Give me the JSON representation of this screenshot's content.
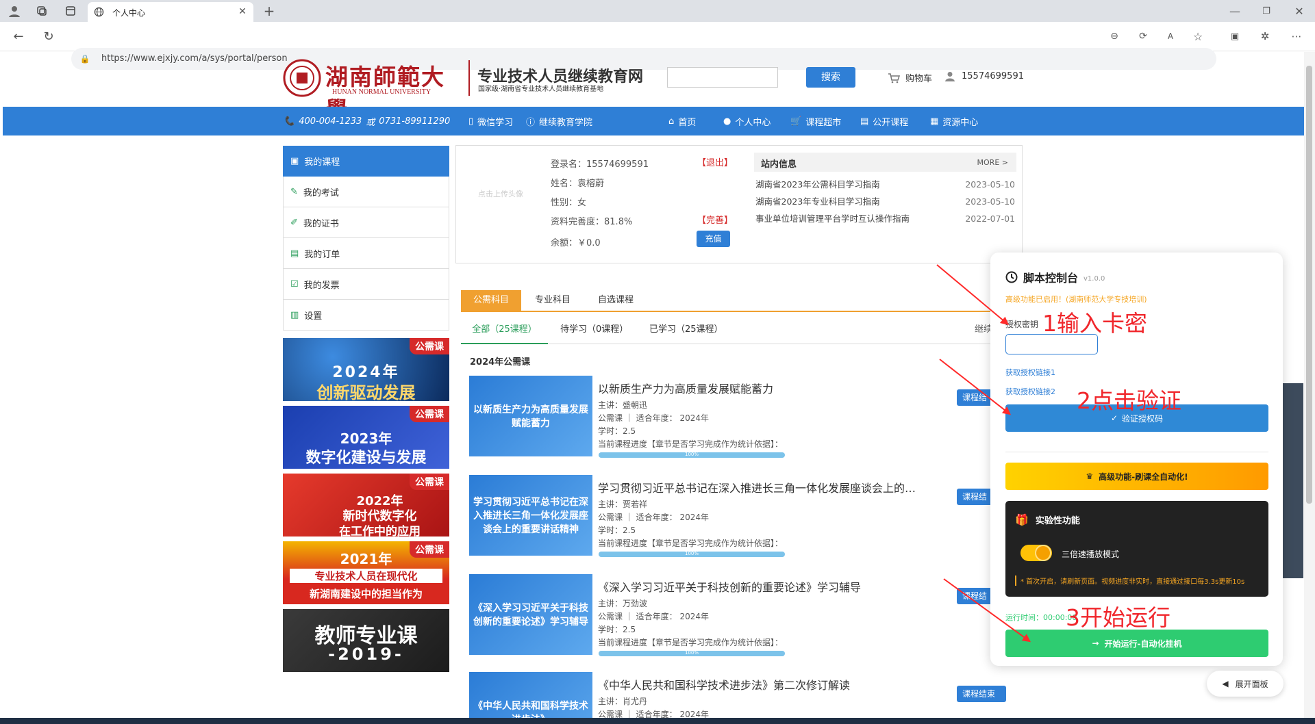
{
  "browser": {
    "tab_title": "个人中心",
    "url": "https://www.ejxjy.com/a/sys/portal/person"
  },
  "header": {
    "logo_cn": "湖南師範大學",
    "logo_en": "HUNAN NORMAL UNIVERSITY",
    "site_name": "专业技术人员继续教育网",
    "site_sub": "国家级·湖南省专业技术人员继续教育基地",
    "search_placeholder": "",
    "search_button": "搜索",
    "cart": "购物车",
    "user": "15574699591"
  },
  "navbar": {
    "phone1": "400-004-1233",
    "or": "或",
    "phone2": "0731-89911290",
    "wechat": "微信学习",
    "college": "继续教育学院",
    "items": [
      "首页",
      "个人中心",
      "课程超市",
      "公开课程",
      "资源中心"
    ]
  },
  "left_menu": [
    "我的课程",
    "我的考试",
    "我的证书",
    "我的订单",
    "我的发票",
    "设置"
  ],
  "banners": [
    {
      "tag": "公需课",
      "line1": "2024年",
      "line2": "创新驱动发展",
      "color": "#0d3b78"
    },
    {
      "tag": "公需课",
      "line1": "2023年",
      "line2": "数字化建设与发展",
      "color": "#1b3fb0"
    },
    {
      "tag": "公需课",
      "line1": "2022年",
      "line2": "新时代数字化",
      "line3": "在工作中的应用",
      "color": "#c51f1f"
    },
    {
      "tag": "公需课",
      "line1": "2021年",
      "line2": "专业技术人员在现代化",
      "line3": "新湖南建设中的担当作为",
      "color": "#d8281f"
    },
    {
      "tag": "",
      "line1": "教师专业课",
      "line2": "-2019-",
      "color": "#2d2d2d"
    }
  ],
  "profile": {
    "avatar_hint": "点击上传头像",
    "login_label": "登录名：",
    "login": "15574699591",
    "logout": "【退出】",
    "name_label": "姓名：",
    "name": "袁榕蔚",
    "gender_label": "性别：",
    "gender": "女",
    "complete_label": "资料完善度：",
    "complete": "81.8%",
    "complete_link": "【完善】",
    "balance_label": "余额：",
    "balance": "￥0.0",
    "recharge": "充值"
  },
  "news": {
    "title": "站内信息",
    "more": "MORE >",
    "items": [
      {
        "text": "湖南省2023年公需科目学习指南",
        "date": "2023-05-10"
      },
      {
        "text": "湖南省2023年专业科目学习指南",
        "date": "2023-05-10"
      },
      {
        "text": "事业单位培训管理平台学时互认操作指南",
        "date": "2022-07-01"
      }
    ]
  },
  "course_tabs": [
    "公需科目",
    "专业科目",
    "自选课程"
  ],
  "sub_tabs": [
    "全部（25课程）",
    "待学习（0课程）",
    "已学习（25课程）"
  ],
  "continue_label": "继续",
  "section_title": "2024年公需课",
  "courses": [
    {
      "thumb": "以新质生产力为高质量发展赋能蓄力",
      "title": "以新质生产力为高质量发展赋能蓄力",
      "teacher": "主讲：盛朝迅",
      "meta": "公需课 ｜ 适合年度： 2024年",
      "hours": "学时：2.5",
      "progress_label": "当前课程进度【章节是否学习完成作为统计依据】：",
      "progress": 1.0,
      "progress_text": "100%",
      "button": "课程结"
    },
    {
      "thumb": "学习贯彻习近平总书记在深入推进长三角一体化发展座谈会上的重要讲话精神",
      "title": "学习贯彻习近平总书记在深入推进长三角一体化发展座谈会上的…",
      "teacher": "主讲：贾若祥",
      "meta": "公需课 ｜ 适合年度： 2024年",
      "hours": "学时：2.5",
      "progress_label": "当前课程进度【章节是否学习完成作为统计依据】：",
      "progress": 1.0,
      "progress_text": "100%",
      "button": "课程结"
    },
    {
      "thumb": "《深入学习习近平关于科技创新的重要论述》学习辅导",
      "title": "《深入学习习近平关于科技创新的重要论述》学习辅导",
      "teacher": "主讲：万劲波",
      "meta": "公需课 ｜ 适合年度： 2024年",
      "hours": "学时：2.5",
      "progress_label": "当前课程进度【章节是否学习完成作为统计依据】：",
      "progress": 1.0,
      "progress_text": "100%",
      "button": "课程结"
    },
    {
      "thumb": "《中华人民共和国科学技术进步法》",
      "title": "《中华人民共和国科学技术进步法》第二次修订解读",
      "teacher": "主讲：肖尤丹",
      "meta": "公需课 ｜ 适合年度： 2024年",
      "hours": "",
      "progress_label": "",
      "progress": 0,
      "progress_text": "",
      "button": "课程结束"
    }
  ],
  "script_panel": {
    "title": "脚本控制台",
    "version": "v1.0.0",
    "notice": "高级功能已启用！(湖南师范大学专技培训)",
    "key_label": "授权密钥",
    "key_value": "",
    "link1": "获取授权链接1",
    "link2": "获取授权链接2",
    "verify": "验证授权码",
    "premium": "高级功能-刷课全自动化!",
    "exp_title": "实验性功能",
    "toggle_label": "三倍速播放模式",
    "toggle_on": true,
    "exp_note": "* 首次开启，请刷新页面。视频进度非实时，直接通过接口每3.3s更新10s",
    "runtime_label": "运行时间：00:00:00",
    "start": "开始运行-自动化挂机",
    "expand": "展开面板"
  },
  "annotations": [
    "1输入卡密",
    "2点击验证",
    "3开始运行"
  ],
  "colors": {
    "brand": "#2f7fd6",
    "red": "#d62a2a",
    "green": "#2ecc71",
    "orange": "#ff9800",
    "gold": "#ffc107"
  }
}
